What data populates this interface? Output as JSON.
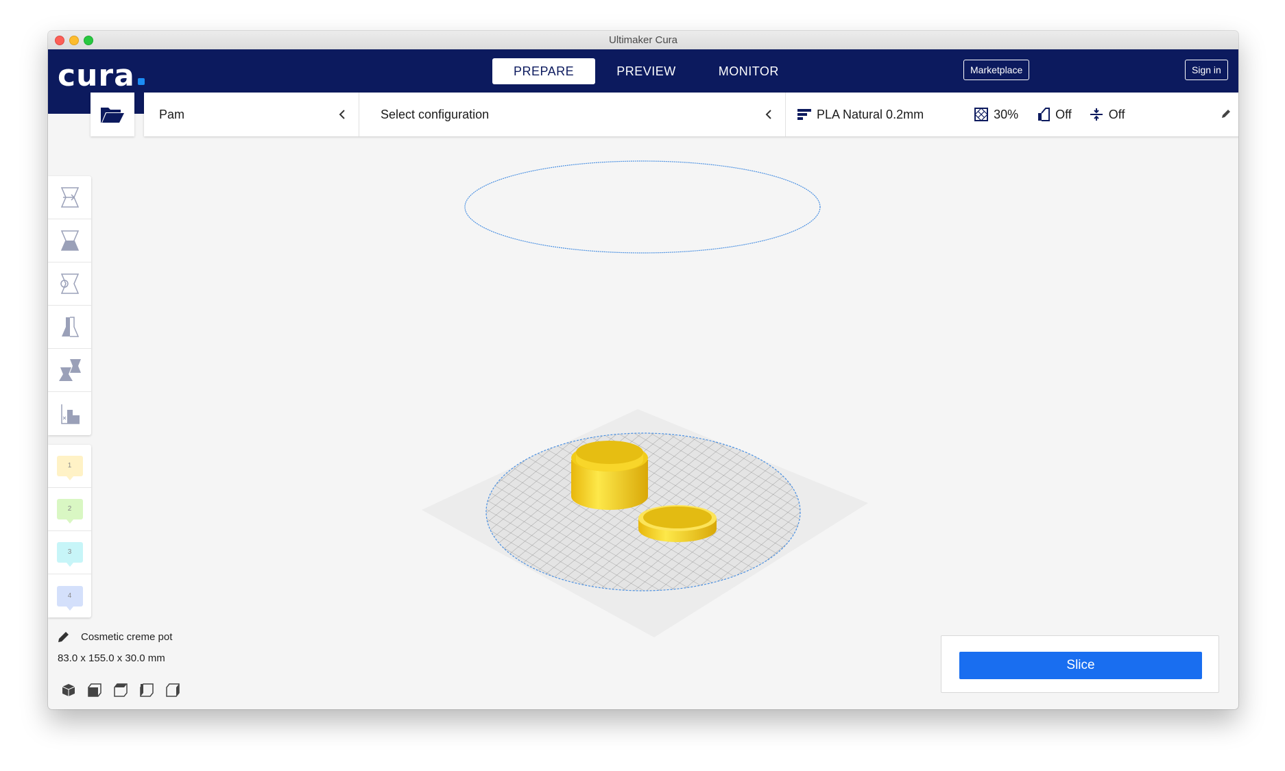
{
  "window": {
    "title": "Ultimaker Cura"
  },
  "header": {
    "logo": "cura",
    "tabs": [
      {
        "label": "PREPARE",
        "active": true
      },
      {
        "label": "PREVIEW",
        "active": false
      },
      {
        "label": "MONITOR",
        "active": false
      }
    ],
    "marketplace_label": "Marketplace",
    "signin_label": "Sign in"
  },
  "toolbar": {
    "printer": "Pam",
    "configuration": "Select configuration",
    "material": "PLA Natural 0.2mm",
    "infill": "30%",
    "support": "Off",
    "adhesion": "Off"
  },
  "left_tools": {
    "icons": [
      "move-icon",
      "scale-icon",
      "rotate-icon",
      "mirror-icon",
      "per-model-settings-icon",
      "support-blocker-icon"
    ],
    "extruders": [
      {
        "label": "1",
        "color": "#fff2c6"
      },
      {
        "label": "2",
        "color": "#d9f7c3"
      },
      {
        "label": "3",
        "color": "#c7f5f8"
      },
      {
        "label": "4",
        "color": "#d4e0fb"
      }
    ]
  },
  "object": {
    "name": "Cosmetic creme pot",
    "dimensions": "83.0 x 155.0 x 30.0 mm"
  },
  "view_buttons": [
    "3d-view-icon",
    "front-view-icon",
    "top-view-icon",
    "left-view-icon",
    "right-view-icon"
  ],
  "slice": {
    "label": "Slice"
  },
  "colors": {
    "header": "#0c1a5e",
    "accent": "#196ef0",
    "model": "#f8d11f"
  }
}
